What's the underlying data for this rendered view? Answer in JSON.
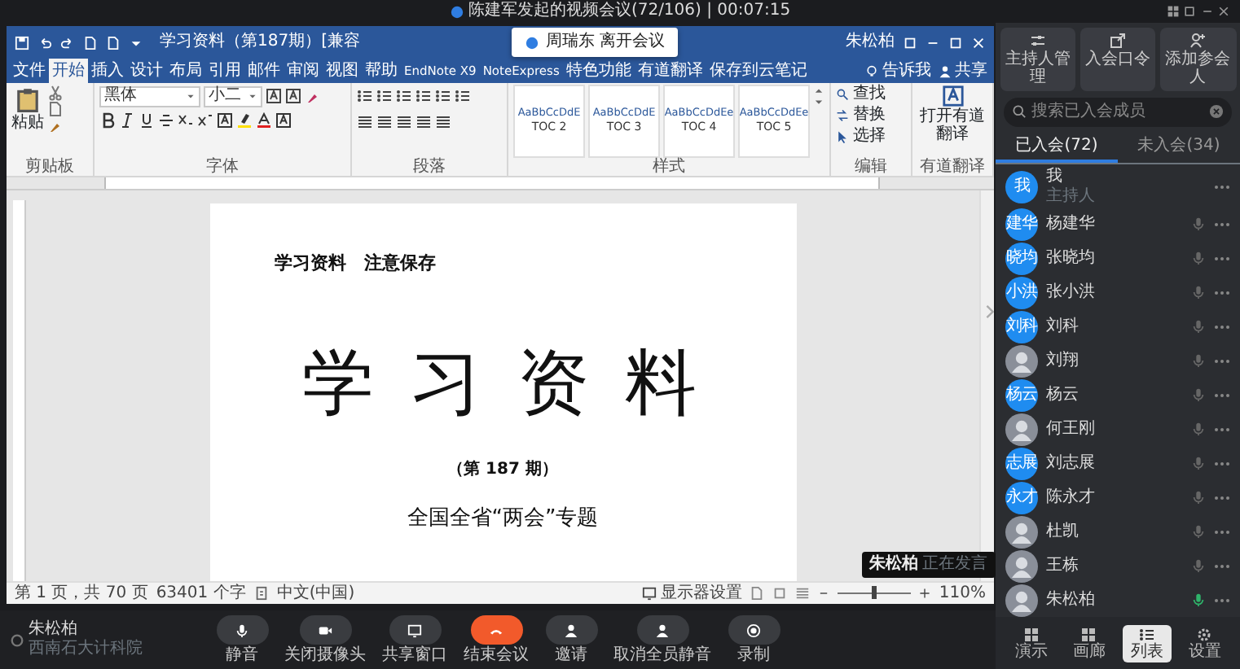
{
  "meeting": {
    "title": "陈建军发起的视频会议(72/106) | 00:07:15"
  },
  "word": {
    "title": "学习资料（第187期）[兼容",
    "user": "朱松柏",
    "tabs": [
      {
        "label": "文件",
        "selected": false
      },
      {
        "label": "开始",
        "selected": true
      },
      {
        "label": "插入",
        "selected": false
      },
      {
        "label": "设计",
        "selected": false
      },
      {
        "label": "布局",
        "selected": false
      },
      {
        "label": "引用",
        "selected": false
      },
      {
        "label": "邮件",
        "selected": false
      },
      {
        "label": "审阅",
        "selected": false
      },
      {
        "label": "视图",
        "selected": false
      },
      {
        "label": "帮助",
        "selected": false
      },
      {
        "label": "EndNote X9",
        "selected": false
      },
      {
        "label": "NoteExpress",
        "selected": false
      },
      {
        "label": "特色功能",
        "selected": false
      },
      {
        "label": "有道翻译",
        "selected": false
      },
      {
        "label": "保存到云笔记",
        "selected": false
      }
    ],
    "tell_me": "告诉我",
    "share": "共享",
    "paste": "粘贴",
    "font": "黑体",
    "size": "小二",
    "groups": [
      "剪贴板",
      "字体",
      "段落",
      "样式",
      "编辑",
      "有道翻译"
    ],
    "styles": [
      {
        "sample": "AaBbCcDdE",
        "name": "TOC 2"
      },
      {
        "sample": "AaBbCcDdE",
        "name": "TOC 3"
      },
      {
        "sample": "AaBbCcDdEe",
        "name": "TOC 4"
      },
      {
        "sample": "AaBbCcDdEe",
        "name": "TOC 5"
      }
    ],
    "editing": [
      "查找",
      "替换",
      "选择"
    ],
    "translate": "打开有道翻译",
    "page": {
      "header": "学习资料　注意保存",
      "title": "学 习 资 料",
      "issue": "（第 187 期）",
      "subtitle": "全国全省“两会”专题"
    },
    "status": {
      "page": "第 1 页，共 70 页",
      "words": "63401 个字",
      "language": "中文(中国)",
      "display": "显示器设置",
      "zoom": "110%",
      "level": 0.5
    }
  },
  "notification": "周瑞东 离开会议",
  "speaker_label": {
    "name": "朱松柏",
    "org": "西南石大计科院"
  },
  "toolbar": [
    {
      "label": "静音",
      "kind": "mic"
    },
    {
      "label": "关闭摄像头",
      "kind": "camera"
    },
    {
      "label": "共享窗口",
      "kind": "share"
    },
    {
      "label": "结束会议",
      "kind": "end"
    },
    {
      "label": "邀请",
      "kind": "invite"
    },
    {
      "label": "取消全员静音",
      "kind": "unmute"
    },
    {
      "label": "录制",
      "kind": "record"
    }
  ],
  "panel": {
    "actions": [
      "主持人管理",
      "入会口令",
      "添加参会人"
    ],
    "search": {
      "placeholder": "搜索已入会成员"
    },
    "tabs": [
      {
        "label": "已入会(72)",
        "selected": true
      },
      {
        "label": "未入会(34)",
        "selected": false
      }
    ],
    "members": [
      {
        "name": "我",
        "role": "主持人",
        "kind": "text",
        "avatar": "我"
      },
      {
        "name": "杨建华",
        "kind": "text",
        "avatar": "建华",
        "muted": true
      },
      {
        "name": "张晓均",
        "kind": "text",
        "avatar": "晓均",
        "muted": true
      },
      {
        "name": "张小洪",
        "kind": "text",
        "avatar": "小洪",
        "muted": true
      },
      {
        "name": "刘科",
        "kind": "text",
        "avatar": "刘科",
        "muted": true
      },
      {
        "name": "刘翔",
        "kind": "photo",
        "muted": true
      },
      {
        "name": "杨云",
        "kind": "text",
        "avatar": "杨云",
        "muted": true
      },
      {
        "name": "何王刚",
        "kind": "photo",
        "muted": true
      },
      {
        "name": "刘志展",
        "kind": "text",
        "avatar": "志展",
        "muted": true
      },
      {
        "name": "陈永才",
        "kind": "text",
        "avatar": "永才",
        "muted": true
      },
      {
        "name": "杜凯",
        "kind": "photo",
        "muted": true
      },
      {
        "name": "王栋",
        "kind": "photo",
        "muted": true
      },
      {
        "name": "朱松柏",
        "kind": "photo",
        "muted": false
      }
    ],
    "speaking": {
      "name": "朱松柏",
      "text": "正在发言"
    },
    "nav": [
      {
        "label": "演示",
        "selected": false
      },
      {
        "label": "画廊",
        "selected": false
      },
      {
        "label": "列表",
        "selected": true
      },
      {
        "label": "设置",
        "selected": false
      }
    ]
  }
}
